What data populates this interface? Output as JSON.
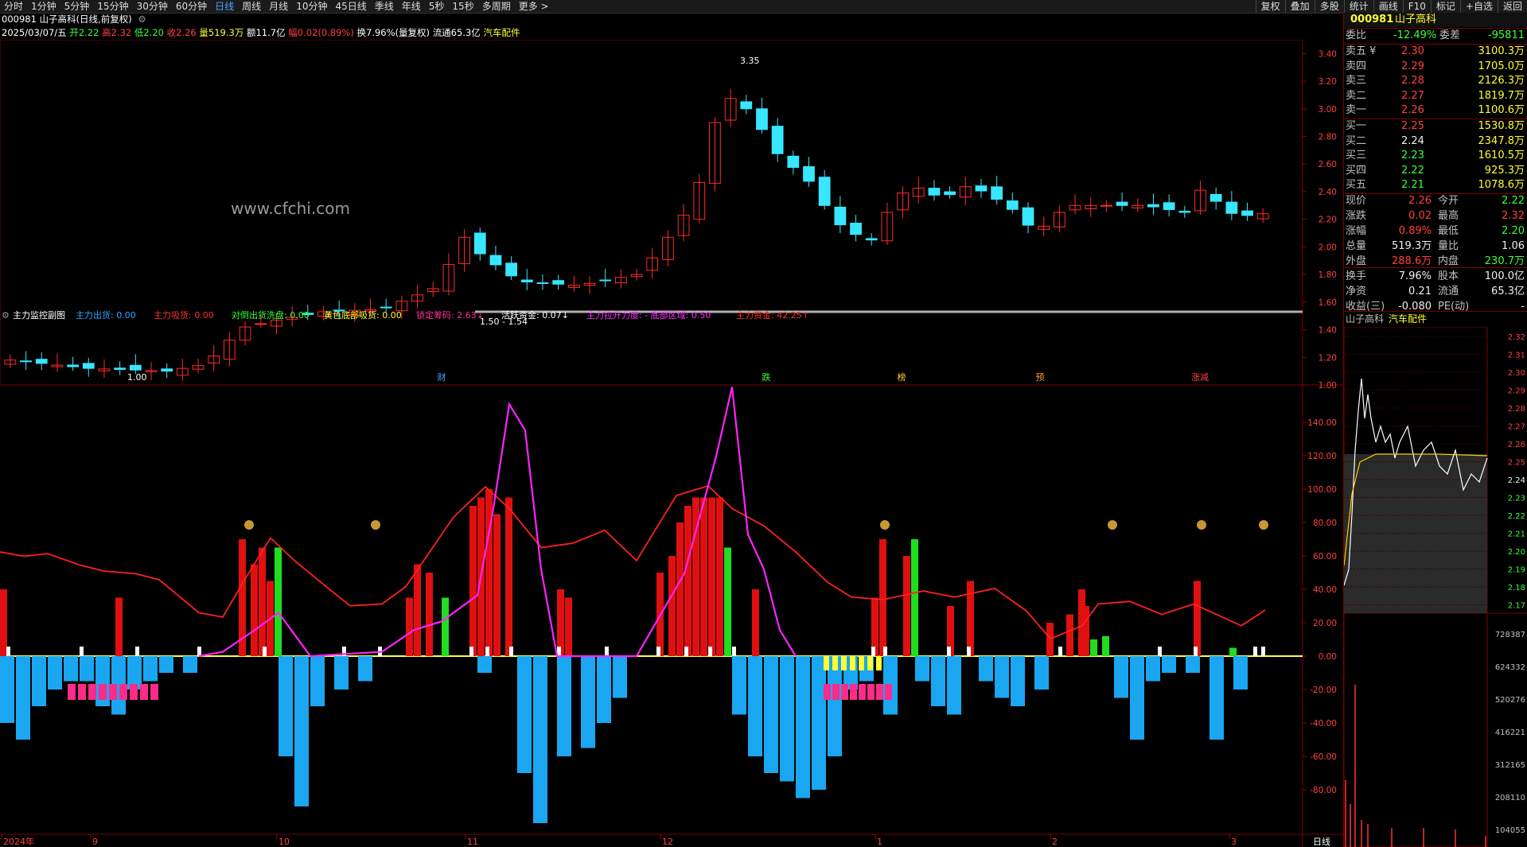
{
  "toolbar": {
    "tabs": [
      "分时",
      "1分钟",
      "5分钟",
      "15分钟",
      "30分钟",
      "60分钟",
      "日线",
      "周线",
      "月线",
      "10分钟",
      "45日线",
      "季线",
      "年线",
      "5秒",
      "15秒",
      "多周期",
      "更多 >"
    ],
    "active_tab": "日线",
    "right_tools": [
      "复权",
      "叠加",
      "多股",
      "统计",
      "画线",
      "F10",
      "标记",
      "+自选",
      "返回"
    ]
  },
  "header": {
    "title": "000981 山子高科(日线,前复权)",
    "date": "2025/03/07/五",
    "open": "开2.22",
    "high": "高2.32",
    "low": "低2.20",
    "close": "收2.26",
    "volume": "量519.3万",
    "amount": "额11.7亿",
    "change": "幅0.02(0.89%)",
    "turnover": "换7.96%(量复权)",
    "float_cap": "流通65.3亿",
    "sector": "汽车配件"
  },
  "watermark": "www.cfchi.com",
  "main_chart": {
    "y_ticks": [
      "3.40",
      "3.20",
      "3.00",
      "2.80",
      "2.60",
      "2.40",
      "2.20",
      "2.00",
      "1.80",
      "1.60",
      "1.40",
      "1.20",
      "1.00"
    ],
    "max_label": "3.35",
    "min_label": "1.00",
    "range_label": "1.50 - 1.54",
    "event_markers": [
      "财",
      "跌",
      "榜",
      "预",
      "涨减"
    ]
  },
  "sub_chart": {
    "title": "主力监控副图",
    "legend": [
      {
        "text": "主力出货: 0.00",
        "color": "#2aa8ff"
      },
      {
        "text": "主力吸货: 0.00",
        "color": "#ff3030"
      },
      {
        "text": "对倒出货洗盘: 0.00",
        "color": "#33ff33"
      },
      {
        "text": "黄色底部吸货: 0.00",
        "color": "#ffff33"
      },
      {
        "text": "锁定筹码: 2.63↓",
        "color": "#ff3399"
      },
      {
        "text": "活跃资金: 0.07↓",
        "color": "#ffffff"
      },
      {
        "text": "主力拉升力度: - 底部区域: 0.50",
        "color": "#ff33ff"
      },
      {
        "text": "主力资金: 42.25↑",
        "color": "#ff3030"
      }
    ],
    "y_ticks": [
      "140.00",
      "120.00",
      "100.00",
      "80.00",
      "60.00",
      "40.00",
      "20.00",
      "0.00",
      "-20.00",
      "-40.00",
      "-60.00",
      "-80.00"
    ]
  },
  "x_axis": {
    "labels": [
      "2024年",
      "9",
      "10",
      "11",
      "12",
      "1",
      "2",
      "3"
    ],
    "period_label": "日线"
  },
  "quote_panel": {
    "code": "000981",
    "name": "山子高科",
    "weibi_label": "委比",
    "weibi": "-12.49%",
    "weicha_label": "委差",
    "weicha": "-95811",
    "asks": [
      {
        "label": "卖五 ¥",
        "price": "2.30",
        "vol": "3100.3万"
      },
      {
        "label": "卖四",
        "price": "2.29",
        "vol": "1705.0万"
      },
      {
        "label": "卖三",
        "price": "2.28",
        "vol": "2126.3万"
      },
      {
        "label": "卖二",
        "price": "2.27",
        "vol": "1819.7万"
      },
      {
        "label": "卖一",
        "price": "2.26",
        "vol": "1100.6万"
      }
    ],
    "bids": [
      {
        "label": "买一",
        "price": "2.25",
        "vol": "1530.8万"
      },
      {
        "label": "买二",
        "price": "2.24",
        "vol": "2347.8万"
      },
      {
        "label": "买三",
        "price": "2.23",
        "vol": "1610.5万"
      },
      {
        "label": "买四",
        "price": "2.22",
        "vol": "925.3万"
      },
      {
        "label": "买五",
        "price": "2.21",
        "vol": "1078.6万"
      }
    ],
    "stats": [
      {
        "l1": "现价",
        "v1": "2.26",
        "l2": "今开",
        "v2": "2.22"
      },
      {
        "l1": "涨跌",
        "v1": "0.02",
        "l2": "最高",
        "v2": "2.32"
      },
      {
        "l1": "涨幅",
        "v1": "0.89%",
        "l2": "最低",
        "v2": "2.20"
      },
      {
        "l1": "总量",
        "v1": "519.3万",
        "l2": "量比",
        "v2": "1.06"
      },
      {
        "l1": "外盘",
        "v1": "288.6万",
        "l2": "内盘",
        "v2": "230.7万"
      },
      {
        "l1": "换手",
        "v1": "7.96%",
        "l2": "股本",
        "v2": "100.0亿"
      },
      {
        "l1": "净资",
        "v1": "0.21",
        "l2": "流通",
        "v2": "65.3亿"
      },
      {
        "l1": "收益(三)",
        "v1": "-0.080",
        "l2": "PE(动)",
        "v2": "-"
      }
    ]
  },
  "intraday": {
    "name": "山子高科",
    "sector": "汽车配件",
    "price_ticks": [
      "2.32",
      "2.31",
      "2.30",
      "2.29",
      "2.28",
      "2.27",
      "2.26",
      "2.25",
      "2.24",
      "2.23",
      "2.22",
      "2.21",
      "2.20",
      "2.19",
      "2.18",
      "2.17"
    ],
    "volume_ticks": [
      "728387",
      "624332",
      "520276",
      "416221",
      "312165",
      "208110",
      "104055"
    ]
  }
}
